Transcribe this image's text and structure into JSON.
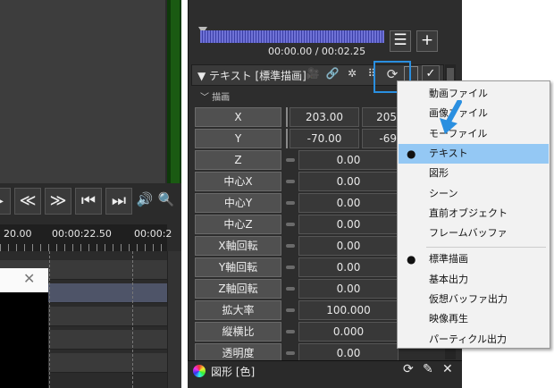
{
  "left": {
    "timeline_ticks": [
      "20.00",
      "00:00:22.50",
      "00:00:2"
    ]
  },
  "player": {
    "time": "00:00.00 / 00:02.25"
  },
  "object": {
    "title": "テキスト [標準描画]",
    "section": "描画",
    "params": [
      {
        "label": "X",
        "value": "203.00",
        "value2": "205"
      },
      {
        "label": "Y",
        "value": "-70.00",
        "value2": "-69"
      },
      {
        "label": "Z",
        "value": "0.00"
      },
      {
        "label": "中心X",
        "value": "0.00"
      },
      {
        "label": "中心Y",
        "value": "0.00"
      },
      {
        "label": "中心Z",
        "value": "0.00"
      },
      {
        "label": "X軸回転",
        "value": "0.00"
      },
      {
        "label": "Y軸回転",
        "value": "0.00"
      },
      {
        "label": "Z軸回転",
        "value": "0.00"
      },
      {
        "label": "拡大率",
        "value": "100.000"
      },
      {
        "label": "縦横比",
        "value": "0.000"
      },
      {
        "label": "透明度",
        "value": "0.00"
      }
    ]
  },
  "footer": {
    "title": "図形 [色]"
  },
  "menu": {
    "items": [
      {
        "label": "動画ファイル",
        "checked": false,
        "highlight": false
      },
      {
        "label": "画像ファイル",
        "checked": false,
        "highlight": false
      },
      {
        "label": "モーファイル",
        "checked": false,
        "highlight": false
      },
      {
        "label": "テキスト",
        "checked": true,
        "highlight": true
      },
      {
        "label": "図形",
        "checked": false,
        "highlight": false
      },
      {
        "label": "シーン",
        "checked": false,
        "highlight": false
      },
      {
        "label": "直前オブジェクト",
        "checked": false,
        "highlight": false
      },
      {
        "label": "フレームバッファ",
        "checked": false,
        "highlight": false
      },
      {
        "label": "標準描画",
        "checked": true,
        "highlight": false
      },
      {
        "label": "基本出力",
        "checked": false,
        "highlight": false
      },
      {
        "label": "仮想バッファ出力",
        "checked": false,
        "highlight": false
      },
      {
        "label": "映像再生",
        "checked": false,
        "highlight": false
      },
      {
        "label": "パーティクル出力",
        "checked": false,
        "highlight": false
      }
    ],
    "bullet": "●"
  },
  "colors": {
    "accent": "#2a8fe0",
    "menu_highlight": "#94c8f4",
    "seek_fill": "#6f72d6"
  },
  "icons": {
    "rewind": "≪",
    "fast_forward": "≫",
    "to_start": "⏮",
    "to_end": "⏭",
    "volume": "🔊",
    "zoom": "🔍",
    "list": "☰",
    "add": "+",
    "refresh": "⟳",
    "link": "🔗",
    "camera": "🎥",
    "dots": "⠿",
    "check": "✓",
    "eyedropper": "✎",
    "close": "✕"
  }
}
